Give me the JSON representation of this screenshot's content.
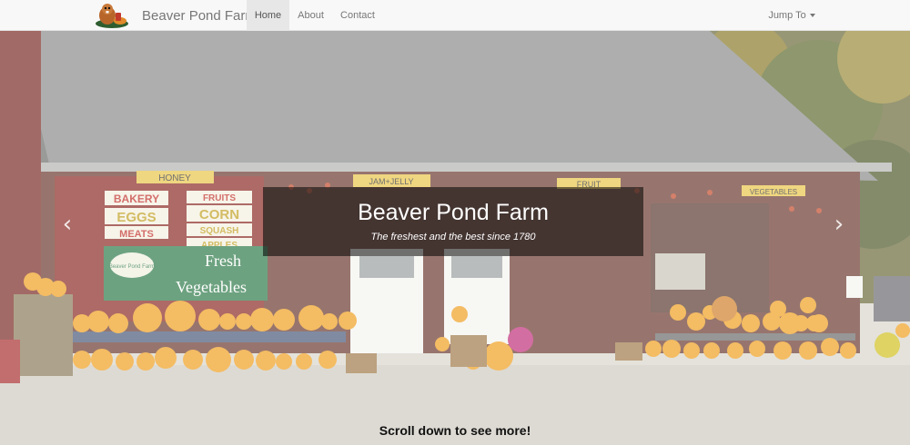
{
  "navbar": {
    "brand": "Beaver Pond Farm",
    "logo_icon": "beaver-mascot-logo",
    "links": [
      {
        "label": "Home",
        "active": true
      },
      {
        "label": "About",
        "active": false
      },
      {
        "label": "Contact",
        "active": false
      }
    ],
    "dropdown": {
      "label": "Jump To",
      "icon": "caret-down-icon"
    }
  },
  "hero": {
    "title": "Beaver Pond Farm",
    "subtitle": "The freshest and the best since 1780",
    "prev_icon": "chevron-left-icon",
    "next_icon": "chevron-right-icon",
    "signs": {
      "honey": "HONEY",
      "jam": "JAM+JELLY",
      "fruit": "FRUIT",
      "vegetables_top": "VEGETABLES",
      "left_stack": [
        "BAKERY",
        "EGGS",
        "MEATS"
      ],
      "mid_stack": [
        "FRUITS",
        "CORN",
        "SQUASH",
        "APPLES"
      ],
      "banner": [
        "Fresh",
        "Vegetables"
      ],
      "banner_logo": "Beaver Pond Farm"
    }
  },
  "footer": {
    "scroll_hint": "Scroll down to see more!"
  },
  "colors": {
    "navbar_bg": "#f8f8f8",
    "active_tab": "#e7e7e7",
    "barn_red": "#8a2a24",
    "pumpkin": "#f0a020",
    "banner_green": "#2f7a4a"
  }
}
